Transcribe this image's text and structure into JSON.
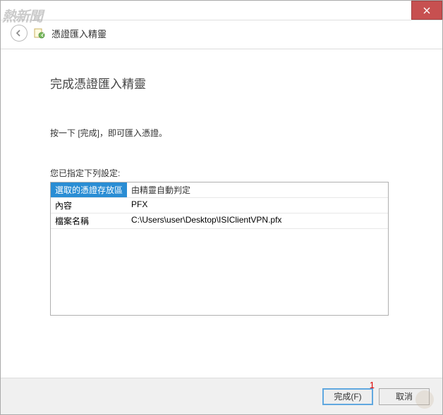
{
  "window": {
    "wizard_title": "憑證匯入精靈"
  },
  "page": {
    "heading": "完成憑證匯入精靈",
    "instruction": "按一下 [完成]，即可匯入憑證。",
    "settings_label": "您已指定下列設定:"
  },
  "settings": {
    "rows": [
      {
        "label": "選取的憑證存放區",
        "value": "由精靈自動判定"
      },
      {
        "label": "內容",
        "value": "PFX"
      },
      {
        "label": "檔案名稱",
        "value": "C:\\Users\\user\\Desktop\\ISIClientVPN.pfx"
      }
    ]
  },
  "buttons": {
    "finish": "完成(F)",
    "cancel": "取消"
  },
  "annotation": {
    "marker": "1"
  },
  "watermark": {
    "text": "熱新聞"
  }
}
